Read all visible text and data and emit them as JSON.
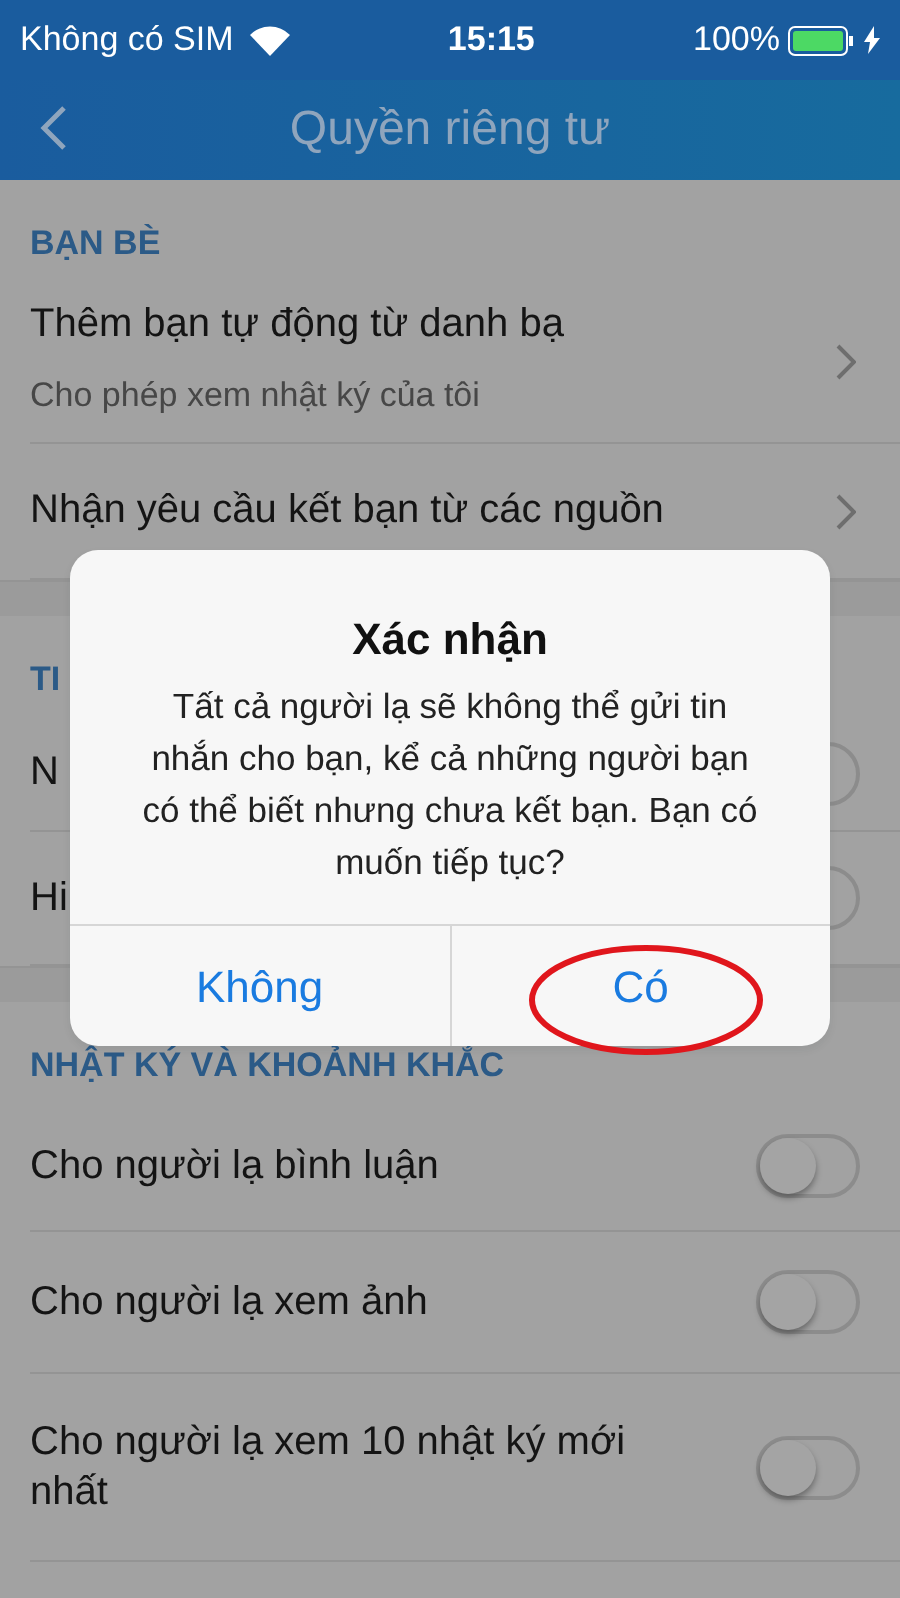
{
  "status_bar": {
    "carrier": "Không có SIM",
    "time": "15:15",
    "battery": "100%"
  },
  "nav": {
    "title": "Quyền riêng tư"
  },
  "sections": [
    {
      "header": "BẠN BÈ",
      "rows": [
        {
          "kind": "link",
          "title": "Thêm bạn tự động từ danh bạ",
          "subtitle": "Cho phép xem nhật ký của tôi"
        },
        {
          "kind": "link",
          "title": "Nhận yêu cầu kết bạn từ các nguồn"
        }
      ]
    },
    {
      "header": "TI",
      "rows": [
        {
          "kind": "toggle",
          "title": "N",
          "on": false
        },
        {
          "kind": "toggle",
          "title": "Hi",
          "on": false
        }
      ]
    },
    {
      "header": "NHẬT KÝ VÀ KHOẢNH KHẮC",
      "rows": [
        {
          "kind": "toggle",
          "title": "Cho người lạ bình luận",
          "on": false
        },
        {
          "kind": "toggle",
          "title": "Cho người lạ xem ảnh",
          "on": false
        },
        {
          "kind": "toggle",
          "title": "Cho người lạ xem 10 nhật ký mới nhất",
          "on": false
        }
      ]
    }
  ],
  "dialog": {
    "title": "Xác nhận",
    "message": "Tất cả người lạ sẽ không thể gửi tin nhắn cho bạn, kể cả những người bạn có thể biết nhưng chưa kết bạn. Bạn có muốn tiếp tục?",
    "buttons": [
      {
        "label": "Không",
        "circled": false
      },
      {
        "label": "Có",
        "circled": true
      }
    ]
  }
}
